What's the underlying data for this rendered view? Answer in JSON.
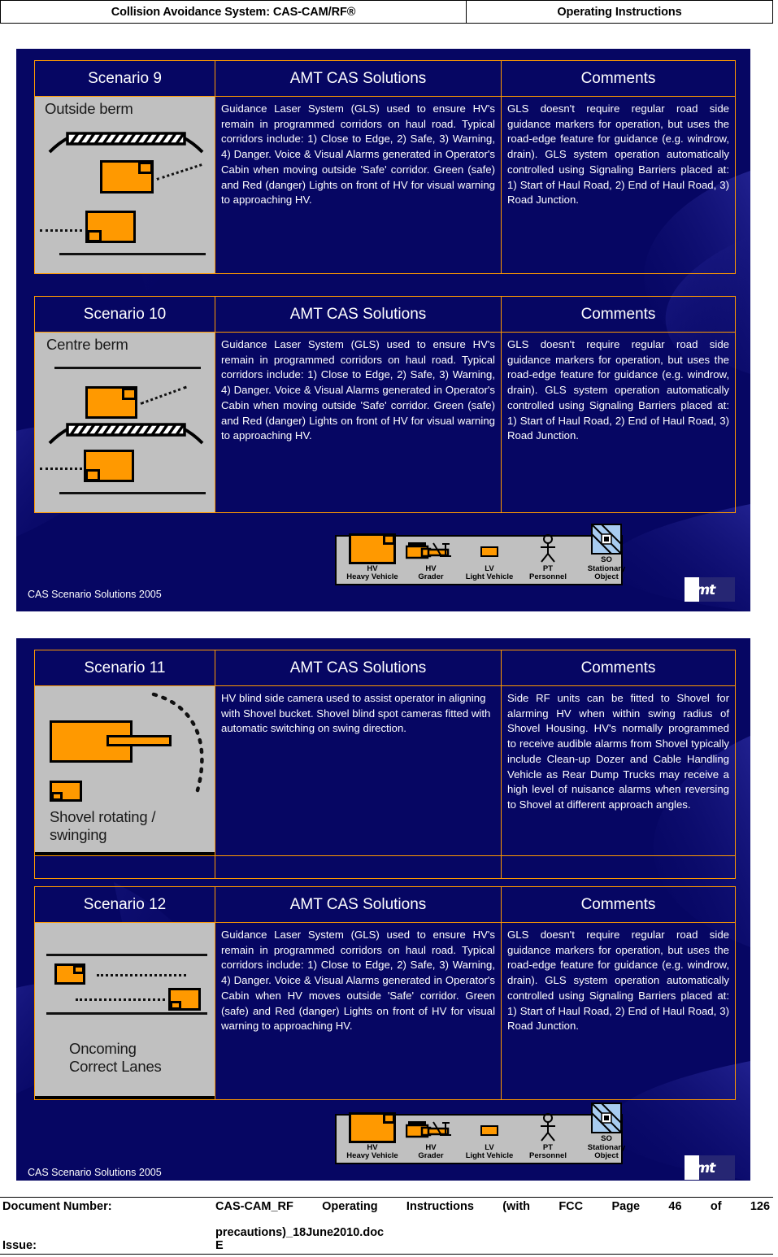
{
  "header": {
    "left": "Collision Avoidance System: CAS-CAM/RF®",
    "right": "Operating Instructions"
  },
  "columns": {
    "solutions": "AMT CAS Solutions",
    "comments": "Comments"
  },
  "text_blocks": {
    "gls_solution_moving": "Guidance Laser System (GLS) used to ensure HV's remain in programmed corridors on haul road. Typical corridors include: 1) Close to Edge, 2) Safe, 3) Warning, 4) Danger. Voice & Visual Alarms generated in Operator's Cabin when moving outside 'Safe' corridor. Green (safe) and Red (danger) Lights on front of HV for visual warning to approaching HV.",
    "gls_solution_hvmoves": "Guidance Laser System (GLS) used to ensure HV's remain in programmed corridors on haul road. Typical corridors include: 1) Close to Edge, 2) Safe, 3) Warning, 4) Danger. Voice & Visual Alarms generated in Operator's Cabin when HV moves outside 'Safe' corridor. Green (safe) and Red (danger) Lights on front of HV for visual warning to approaching HV.",
    "gls_comment": "GLS doesn't require regular road side guidance markers for operation, but uses the road-edge feature for guidance (e.g. windrow, drain).  GLS system operation automatically controlled using Signaling Barriers placed at: 1) Start of Haul Road, 2) End of Haul Road, 3) Road Junction.",
    "shovel_solution": "HV blind side camera used to assist operator in aligning with Shovel bucket. Shovel blind spot cameras fitted with automatic switching on swing direction.",
    "shovel_comment": "Side RF units can be fitted to Shovel for alarming HV when within swing radius of Shovel Housing. HV's normally programmed to receive audible alarms from Shovel typically include Clean-up Dozer and Cable Handling Vehicle as Rear Dump Trucks may receive a high level of nuisance alarms when reversing to Shovel at different approach angles."
  },
  "scenarios": [
    {
      "id": "scenario-9",
      "title": "Scenario 9",
      "diagram_label": "Outside berm"
    },
    {
      "id": "scenario-10",
      "title": "Scenario 10",
      "diagram_label": "Centre berm"
    },
    {
      "id": "scenario-11",
      "title": "Scenario 11",
      "diagram_label": "Shovel rotating /\nswinging"
    },
    {
      "id": "scenario-12",
      "title": "Scenario 12",
      "diagram_label": "Oncoming\nCorrect Lanes"
    }
  ],
  "legend": {
    "items": [
      {
        "code": "HV",
        "name": "Heavy Vehicle",
        "icon": "heavy-vehicle-icon"
      },
      {
        "code": "HV",
        "name": "Grader",
        "icon": "grader-icon"
      },
      {
        "code": "LV",
        "name": "Light Vehicle",
        "icon": "light-vehicle-icon"
      },
      {
        "code": "PT",
        "name": "Personnel",
        "icon": "personnel-icon"
      },
      {
        "code": "SO",
        "name": "Stationary Object",
        "icon": "stationary-object-icon"
      }
    ]
  },
  "slide_footer": "CAS Scenario Solutions 2005",
  "logo": {
    "text": "amt"
  },
  "doc_footer": {
    "document_number_label": "Document Number:",
    "document_number_value": "CAS-CAM_RF Operating Instructions (with FCC",
    "page_label": "Page 46 of 126",
    "document_number_value_line2": "precautions)_18June2010.doc",
    "issue_label": "Issue:",
    "issue_value": "E"
  },
  "colors": {
    "slide_bg": "#060663",
    "accent_orange": "#FF9900",
    "illustration_bg": "#C0C0C0",
    "text_white": "#FFFFFF",
    "object_fill": "#FF9900",
    "stationary_fill": "#A8CCF0"
  }
}
